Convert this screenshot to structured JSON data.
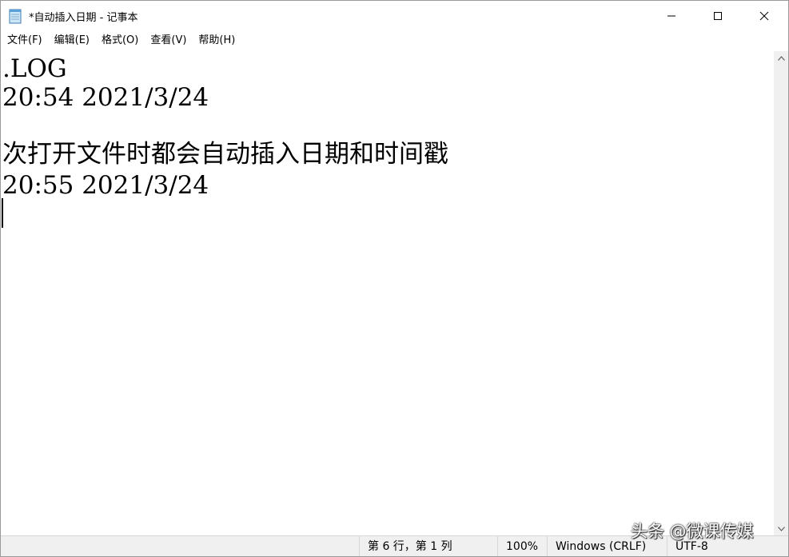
{
  "window": {
    "title": "*自动插入日期 - 记事本"
  },
  "menu": {
    "items": [
      "文件(F)",
      "编辑(E)",
      "格式(O)",
      "查看(V)",
      "帮助(H)"
    ]
  },
  "editor": {
    "lines": [
      ".LOG",
      "20:54 2021/3/24",
      "",
      "次打开文件时都会自动插入日期和时间戳",
      "20:55 2021/3/24"
    ]
  },
  "status": {
    "position": "第 6 行，第 1 列",
    "zoom": "100%",
    "line_ending": "Windows (CRLF)",
    "encoding": "UTF-8"
  },
  "watermark": {
    "text": "头条 @微课传媒"
  },
  "icons": {
    "app": "notepad-icon",
    "minimize": "minimize-icon",
    "maximize": "maximize-icon",
    "close": "close-icon",
    "scroll_up": "scroll-up-arrow-icon",
    "scroll_down": "scroll-down-arrow-icon"
  }
}
